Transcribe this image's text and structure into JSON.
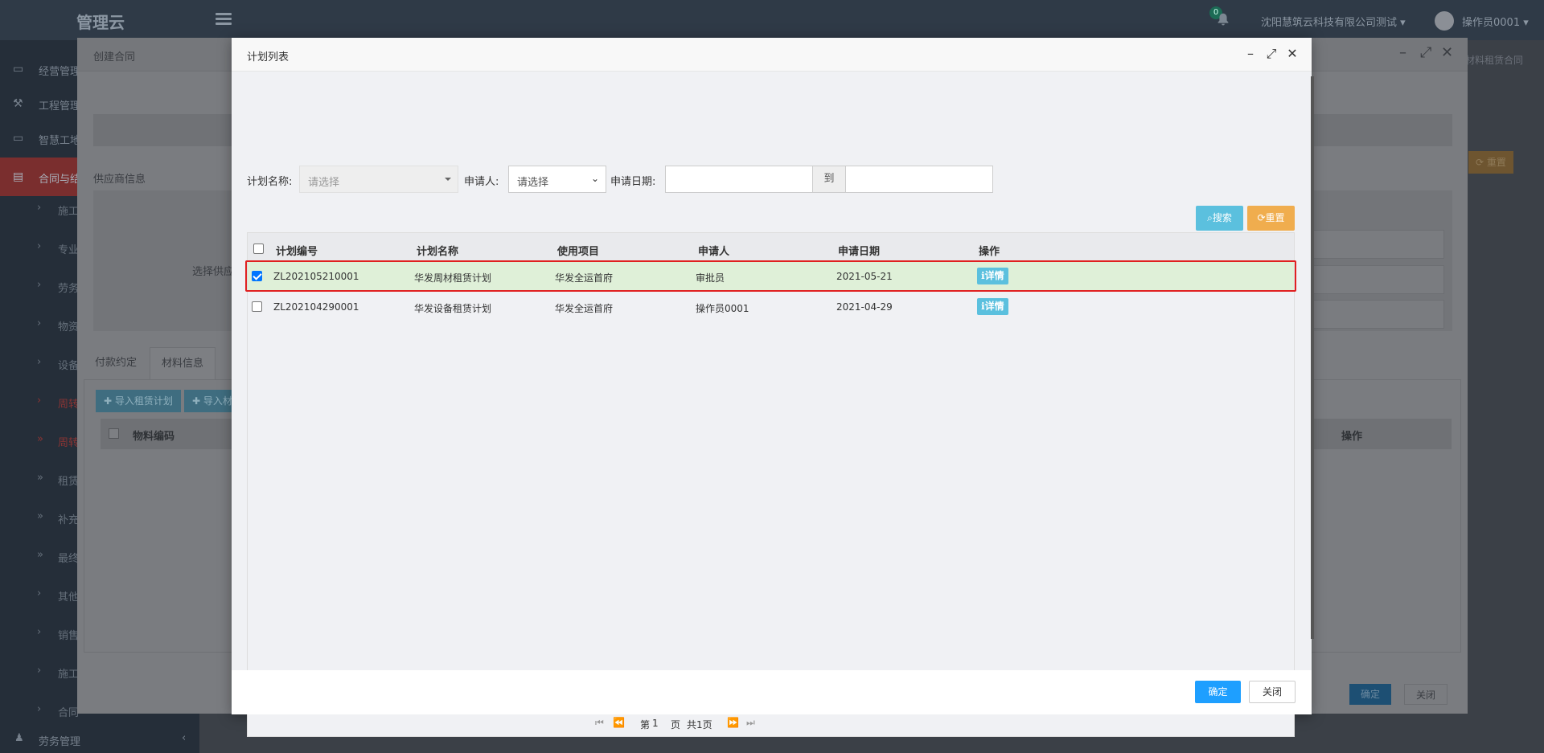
{
  "app": {
    "logo": "管理云",
    "notification_count": "0",
    "company": "沈阳慧筑云科技有限公司测试",
    "user": "操作员0001"
  },
  "sidebar": {
    "items": [
      {
        "label": "经营管理",
        "icon": "monitor-icon"
      },
      {
        "label": "工程管理",
        "icon": "hammer-icon"
      },
      {
        "label": "智慧工地",
        "icon": "monitor-icon"
      },
      {
        "label": "合同与结",
        "icon": "file-icon"
      }
    ],
    "subitems": [
      "施工",
      "专业",
      "劳务",
      "物资",
      "设备",
      "周转",
      "周转",
      "租赁",
      "补充",
      "最终",
      "其他",
      "销售",
      "施工",
      "合同"
    ],
    "bottom_item": "劳务管理"
  },
  "background": {
    "right_tab": "材料租赁合同",
    "modal_title": "创建合同",
    "supplier_section": "供应商信息",
    "select_supplier_label": "选择供应",
    "reset_label": "重置",
    "tabs": [
      "付款约定",
      "材料信息"
    ],
    "import_plan_button": "导入租赁计划",
    "import_other_button": "导入材",
    "col_material_code": "物料编码",
    "col_action": "操作",
    "ok_label": "确定",
    "close_label": "关闭"
  },
  "dialog": {
    "title": "计划列表",
    "filters": {
      "plan_name_label": "计划名称:",
      "plan_name_placeholder": "请选择",
      "applicant_label": "申请人:",
      "applicant_value": "请选择",
      "date_label": "申请日期:",
      "date_to": "到",
      "date_from_value": "",
      "date_to_value": ""
    },
    "search_button": "搜索",
    "reset_button": "重置",
    "table": {
      "columns": [
        "计划编号",
        "计划名称",
        "使用项目",
        "申请人",
        "申请日期",
        "操作"
      ],
      "rows": [
        {
          "code": "ZL202105210001",
          "name": "华发周材租赁计划",
          "project": "华发全运首府",
          "applicant": "审批员",
          "date": "2021-05-21",
          "action": "详情",
          "checked": true
        },
        {
          "code": "ZL202104290001",
          "name": "华发设备租赁计划",
          "project": "华发全运首府",
          "applicant": "操作员0001",
          "date": "2021-04-29",
          "action": "详情",
          "checked": false
        }
      ]
    },
    "pager": {
      "page_prefix": "第",
      "page_value": "1",
      "page_suffix": "页",
      "total": "共1页"
    },
    "ok_button": "确定",
    "close_button": "关闭"
  },
  "colors": {
    "search_btn": "#5bc0de",
    "reset_btn": "#f0ad4e",
    "ok_btn": "#1e9fff",
    "selected_row": "#dff0d8",
    "highlight_border": "#e02020"
  }
}
